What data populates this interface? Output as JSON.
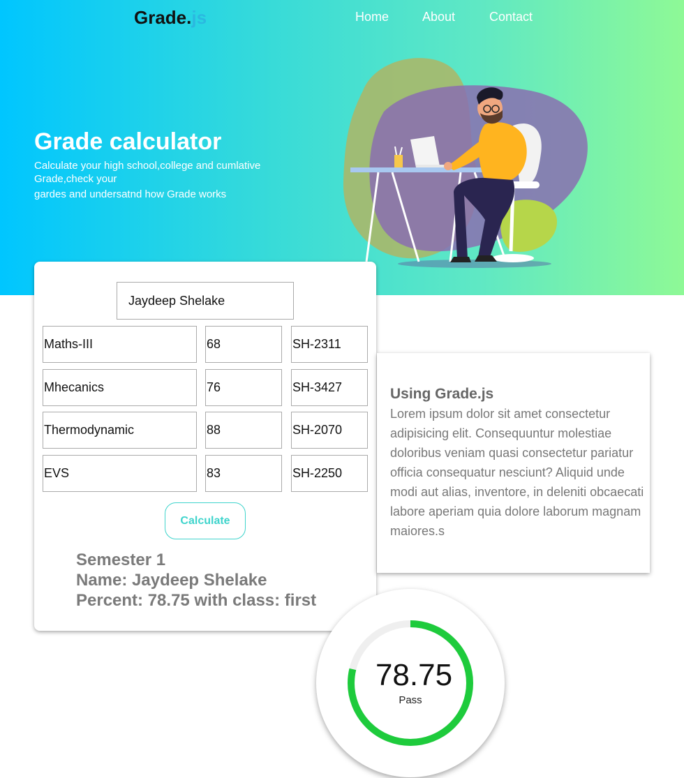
{
  "nav": {
    "brand": "Grade.",
    "brand_suffix": "js",
    "links": [
      "Home",
      "About",
      "Contact"
    ]
  },
  "hero": {
    "title": "Grade calculator",
    "subtitle_line1": "Calculate your high school,college and cumlative Grade,check your",
    "subtitle_line2": "gardes and undersatnd how Grade works"
  },
  "form": {
    "name_value": "Jaydeep Shelake",
    "rows": [
      {
        "subject": "Maths-III",
        "marks": "68",
        "code": "SH-2311"
      },
      {
        "subject": "Mhecanics",
        "marks": "76",
        "code": "SH-3427"
      },
      {
        "subject": "Thermodynamic",
        "marks": "88",
        "code": "SH-2070"
      },
      {
        "subject": "EVS",
        "marks": "83",
        "code": "SH-2250"
      }
    ],
    "calculate_label": "Calculate"
  },
  "result": {
    "semester": "Semester 1",
    "name": "Name: Jaydeep Shelake",
    "percent": "Percent: 78.75 with class: first"
  },
  "info": {
    "title": "Using Grade.js",
    "body": "Lorem ipsum dolor sit amet consectetur adipisicing elit. Consequuntur molestiae doloribus veniam quasi consectetur pariatur officia consequatur nesciunt? Aliquid unde modi aut alias, inventore, in deleniti obcaecati labore aperiam quia dolore laborum magnam maiores.s"
  },
  "gauge": {
    "value": "78.75",
    "label": "Pass",
    "fraction": 0.7875,
    "color": "#1ecb3c",
    "track_color": "#efefef"
  },
  "colors": {
    "accent": "#3fd4cc",
    "gradient_start": "#00c6ff",
    "gradient_end": "#8ef996"
  }
}
